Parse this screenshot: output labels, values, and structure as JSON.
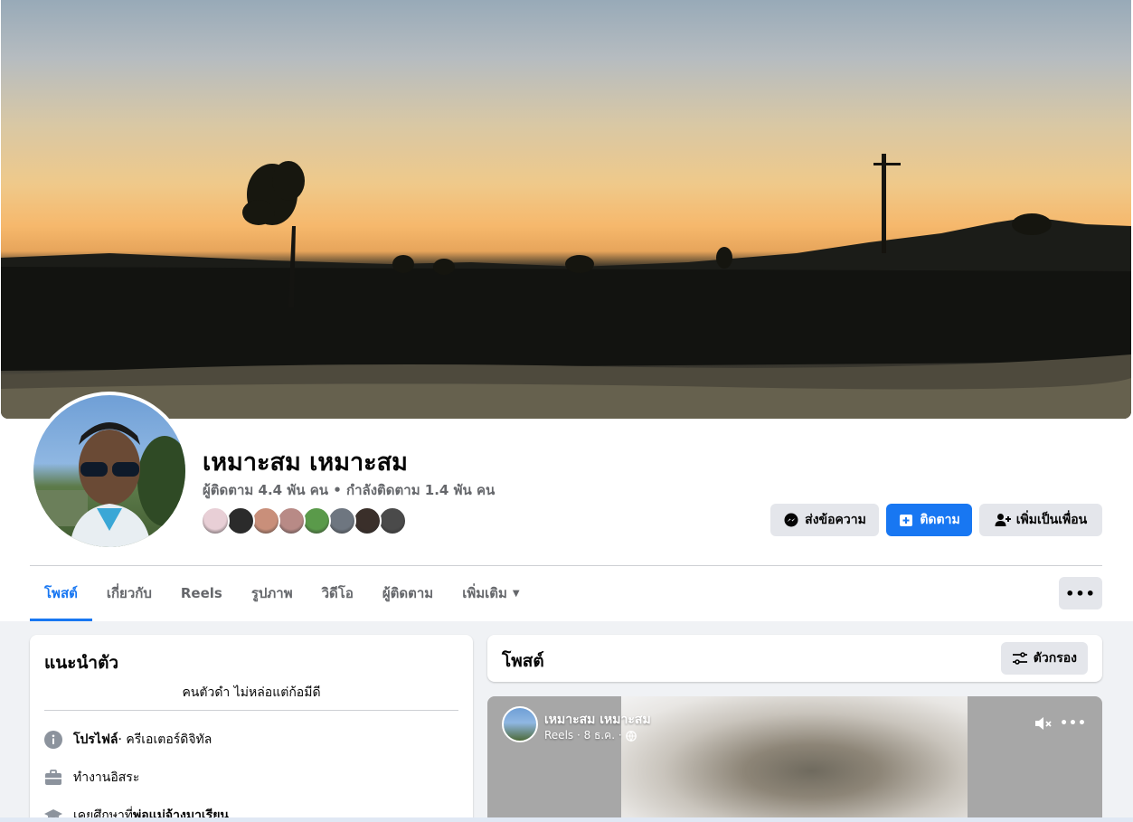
{
  "profile": {
    "name": "เหมาะสม เหมาะสม",
    "stats": "ผู้ติดตาม 4.4 พัน คน • กำลังติดตาม 1.4 พัน คน",
    "friend_avatar_colors": [
      "#e8cfd6",
      "#2b2b2b",
      "#c98f7a",
      "#b88a86",
      "#5a9a4a",
      "#6e7680",
      "#3a2f2a",
      "#4a4a4a"
    ]
  },
  "actions": {
    "message_label": "ส่งข้อความ",
    "follow_label": "ติดตาม",
    "add_friend_label": "เพิ่มเป็นเพื่อน",
    "more_label": "•••"
  },
  "tabs": [
    {
      "label": "โพสต์"
    },
    {
      "label": "เกี่ยวกับ"
    },
    {
      "label": "Reels"
    },
    {
      "label": "รูปภาพ"
    },
    {
      "label": "วิดีโอ"
    },
    {
      "label": "ผู้ติดตาม"
    },
    {
      "label": "เพิ่มเติม"
    }
  ],
  "intro": {
    "title": "แนะนำตัว",
    "bio": "คนตัวดำ ไม่หล่อแต่ก้อมีดี",
    "rows": [
      {
        "bold": "โปรไฟล์",
        "text": " · ครีเอเตอร์ดิจิทัล"
      },
      {
        "bold": "",
        "text": "ทำงานอิสระ"
      },
      {
        "bold": "พ่อแม่จ้างมาเรียน",
        "text": "เคยศึกษาที่ "
      }
    ]
  },
  "posts": {
    "title": "โพสต์",
    "filter_label": "ตัวกรอง"
  },
  "reel": {
    "author": "เหมาะสม เหมาะสม",
    "meta": "Reels · 8 ธ.ค. ·",
    "more_label": "•••"
  },
  "colors": {
    "accent": "#1877f2",
    "page_bg": "#f0f2f5",
    "secondary_text": "#65676b",
    "button_grey": "#e4e6eb"
  }
}
